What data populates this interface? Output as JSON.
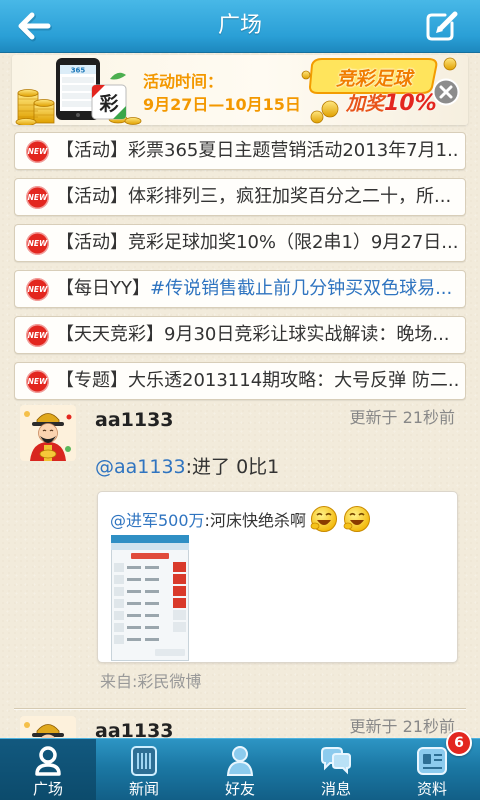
{
  "header": {
    "title": "广场",
    "back_icon": "back-arrow-icon",
    "edit_icon": "edit-icon"
  },
  "banner": {
    "time_label": "活动时间：",
    "time_range": "9月27日—10月15日",
    "promo_title": "竞彩足球",
    "promo_bonus_prefix": "加奖",
    "promo_bonus_value": "10%",
    "phone_logo": "365",
    "tile_char": "彩",
    "close_icon": "close-icon"
  },
  "announcements": [
    {
      "badge": "NEW",
      "tag": "【活动】",
      "text": "彩票365夏日主题营销活动2013年7月1..."
    },
    {
      "badge": "NEW",
      "tag": "【活动】",
      "text": "体彩排列三，疯狂加奖百分之二十，所..."
    },
    {
      "badge": "NEW",
      "tag": "【活动】",
      "text": "竞彩足球加奖10%（限2串1）9月27日..."
    },
    {
      "badge": "NEW",
      "tag": "【每日YY】",
      "text": "#传说销售截止前几分钟买双色球易..."
    },
    {
      "badge": "NEW",
      "tag": "【天天竞彩】",
      "text": "9月30日竞彩让球实战解读：晚场..."
    },
    {
      "badge": "NEW",
      "tag": "【专题】",
      "text": "大乐透2013114期攻略：大号反弹 防二..."
    }
  ],
  "feed": [
    {
      "username": "aa1133",
      "updated": "更新于 21秒前",
      "mention": "@aa1133",
      "text": ":进了 0比1",
      "repost": {
        "mention": "@进军500万",
        "text": ":河床快绝杀啊",
        "emojis": [
          "grin-emoji",
          "grin-emoji"
        ]
      },
      "source": "来自:彩民微博"
    },
    {
      "username": "aa1133",
      "updated": "更新于 21秒前"
    }
  ],
  "tabs": [
    {
      "label": "广场",
      "icon": "plaza-icon",
      "selected": true
    },
    {
      "label": "新闻",
      "icon": "news-icon"
    },
    {
      "label": "好友",
      "icon": "friends-icon"
    },
    {
      "label": "消息",
      "icon": "messages-icon"
    },
    {
      "label": "资料",
      "icon": "profile-icon",
      "badge": "6"
    }
  ],
  "colors": {
    "header": "#2a9fd6",
    "tab_bar": "#1b78a4",
    "tab_selected": "#0c4b6c",
    "page_background": "#f2ebdb",
    "new_badge": "#e3261f",
    "link": "#2f74c0",
    "promo_orange": "#f39800",
    "count_badge": "#e3261f"
  }
}
